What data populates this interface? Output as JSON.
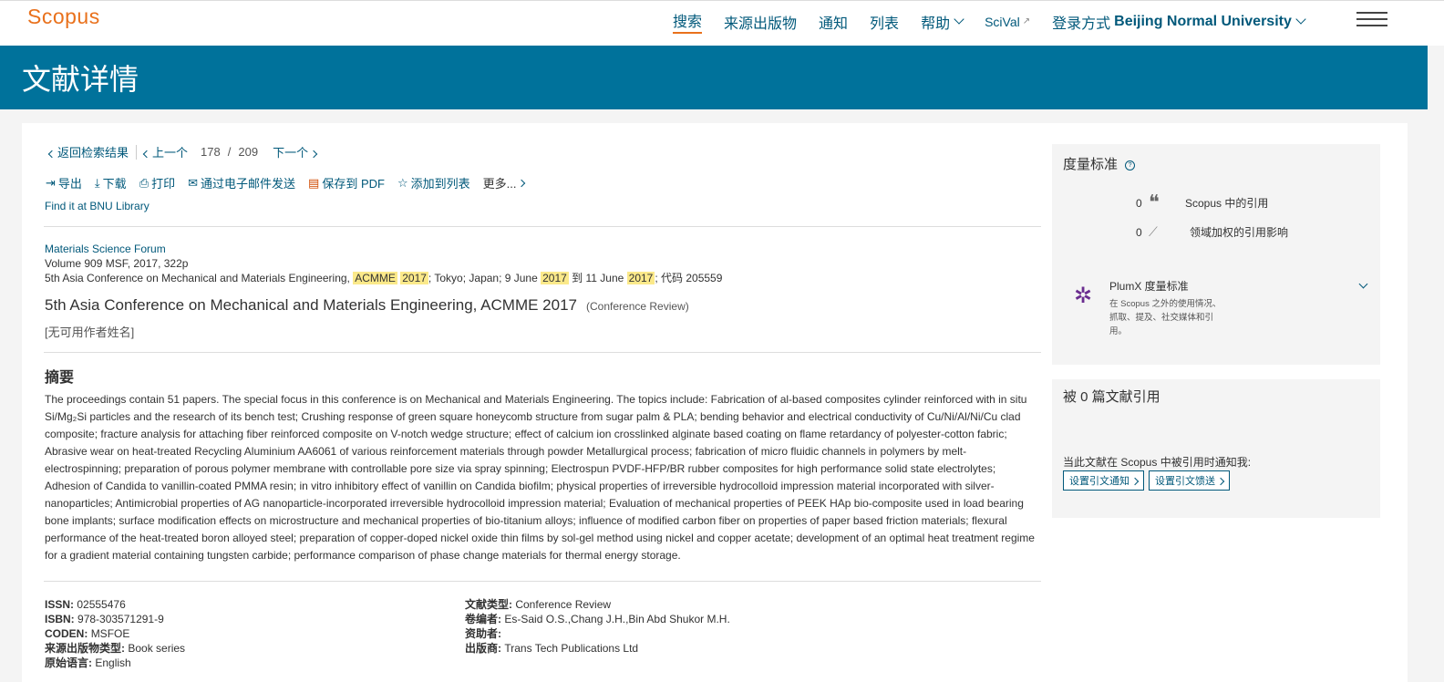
{
  "header": {
    "logo": "Scopus",
    "nav": [
      "搜索",
      "来源出版物",
      "通知",
      "列表"
    ],
    "help": "帮助",
    "scival": "SciVal",
    "scival_ext": "↗",
    "login_label": "登录方式",
    "institution": "Beijing Normal University"
  },
  "page_title": "文献详情",
  "breadcrumb": {
    "back": "返回检索结果",
    "prev": "上一个",
    "current": "178",
    "slash": "/",
    "total": "209",
    "next": "下一个"
  },
  "actions": {
    "export": "导出",
    "download": "下载",
    "print": "打印",
    "email": "通过电子邮件发送",
    "pdf": "保存到 PDF",
    "add_list": "添加到列表",
    "more": "更多..."
  },
  "findit": "Find it at BNU Library",
  "source": {
    "journal": "Materials Science Forum",
    "volume": "Volume 909 MSF, 2017, 322p",
    "conf_a": "5th Asia Conference on Mechanical and Materials Engineering, ",
    "hl_acmme": "ACMME",
    "hl_2017_a": "2017",
    "conf_b": "; Tokyo; Japan; 9 June ",
    "hl_2017_b": "2017",
    "conf_c": " 到 11 June ",
    "hl_2017_c": "2017",
    "conf_d": "; 代码 205559"
  },
  "doc_title": "5th Asia Conference on Mechanical and Materials Engineering, ACMME 2017",
  "doc_type_tag": "(Conference Review)",
  "authors": "[无可用作者姓名]",
  "abstract_heading": "摘要",
  "abstract": "The proceedings contain 51 papers. The special focus in this conference is on Mechanical and Materials Engineering. The topics include: Fabrication of al-based composites cylinder reinforced with in situ Si/Mg₂Si particles and the research of its bench test; Crushing response of green square honeycomb structure from sugar palm & PLA; bending behavior and electrical conductivity of Cu/Ni/Al/Ni/Cu clad composite; fracture analysis for attaching fiber reinforced composite on V-notch wedge structure; effect of calcium ion crosslinked alginate based coating on flame retardancy of polyester-cotton fabric; Abrasive wear on heat-treated Recycling Aluminium AA6061 of various reinforcement materials through powder Metallurgical process; fabrication of micro fluidic channels in polymers by melt-electrospinning; preparation of porous polymer membrane with controllable pore size via spray spinning; Electrospun PVDF-HFP/BR rubber composites for high performance solid state electrolytes; Adhesion of Candida to vanillin-coated PMMA resin; in vitro inhibitory effect of vanillin on Candida biofilm; physical properties of irreversible hydrocolloid impression material incorporated with silver-nanoparticles; Antimicrobial properties of AG nanoparticle-incorporated irreversible hydrocolloid impression material; Evaluation of mechanical properties of PEEK HAp bio-composite used in load bearing bone implants; surface modification effects on microstructure and mechanical properties of bio-titanium alloys; influence of modified carbon fiber on properties of paper based friction materials; flexural performance of the heat-treated boron alloyed steel; preparation of copper-doped nickel oxide thin films by sol-gel method using nickel and copper acetate; development of an optimal heat treatment regime for a gradient material containing tungsten carbide; performance comparison of phase change materials for thermal energy storage.",
  "meta_left": [
    {
      "label": "ISSN:",
      "value": "02555476"
    },
    {
      "label": "ISBN:",
      "value": "978-303571291-9"
    },
    {
      "label": "CODEN:",
      "value": "MSFOE"
    },
    {
      "label": "来源出版物类型:",
      "value": "Book series"
    },
    {
      "label": "原始语言:",
      "value": "English"
    }
  ],
  "meta_right": [
    {
      "label": "文献类型:",
      "value": "Conference Review"
    },
    {
      "label": "卷编者:",
      "value": "Es-Said O.S.,Chang J.H.,Bin Abd Shukor M.H."
    },
    {
      "label": "资助者:",
      "value": ""
    },
    {
      "label": "出版商:",
      "value": "Trans Tech Publications Ltd"
    }
  ],
  "metrics": {
    "heading": "度量标准",
    "help": "?",
    "citations_count": "0",
    "citations_label": "Scopus 中的引用",
    "fwci_count": "0",
    "fwci_label": "领域加权的引用影响",
    "plumx_title": "PlumX 度量标准",
    "plumx_desc": "在 Scopus 之外的使用情况、抓取、提及、社交媒体和引用。"
  },
  "cited_by": {
    "heading": "被 0 篇文献引用",
    "notify": "当此文献在 Scopus 中被引用时通知我:",
    "alert_btn": "设置引文通知",
    "feed_btn": "设置引文馈送"
  }
}
